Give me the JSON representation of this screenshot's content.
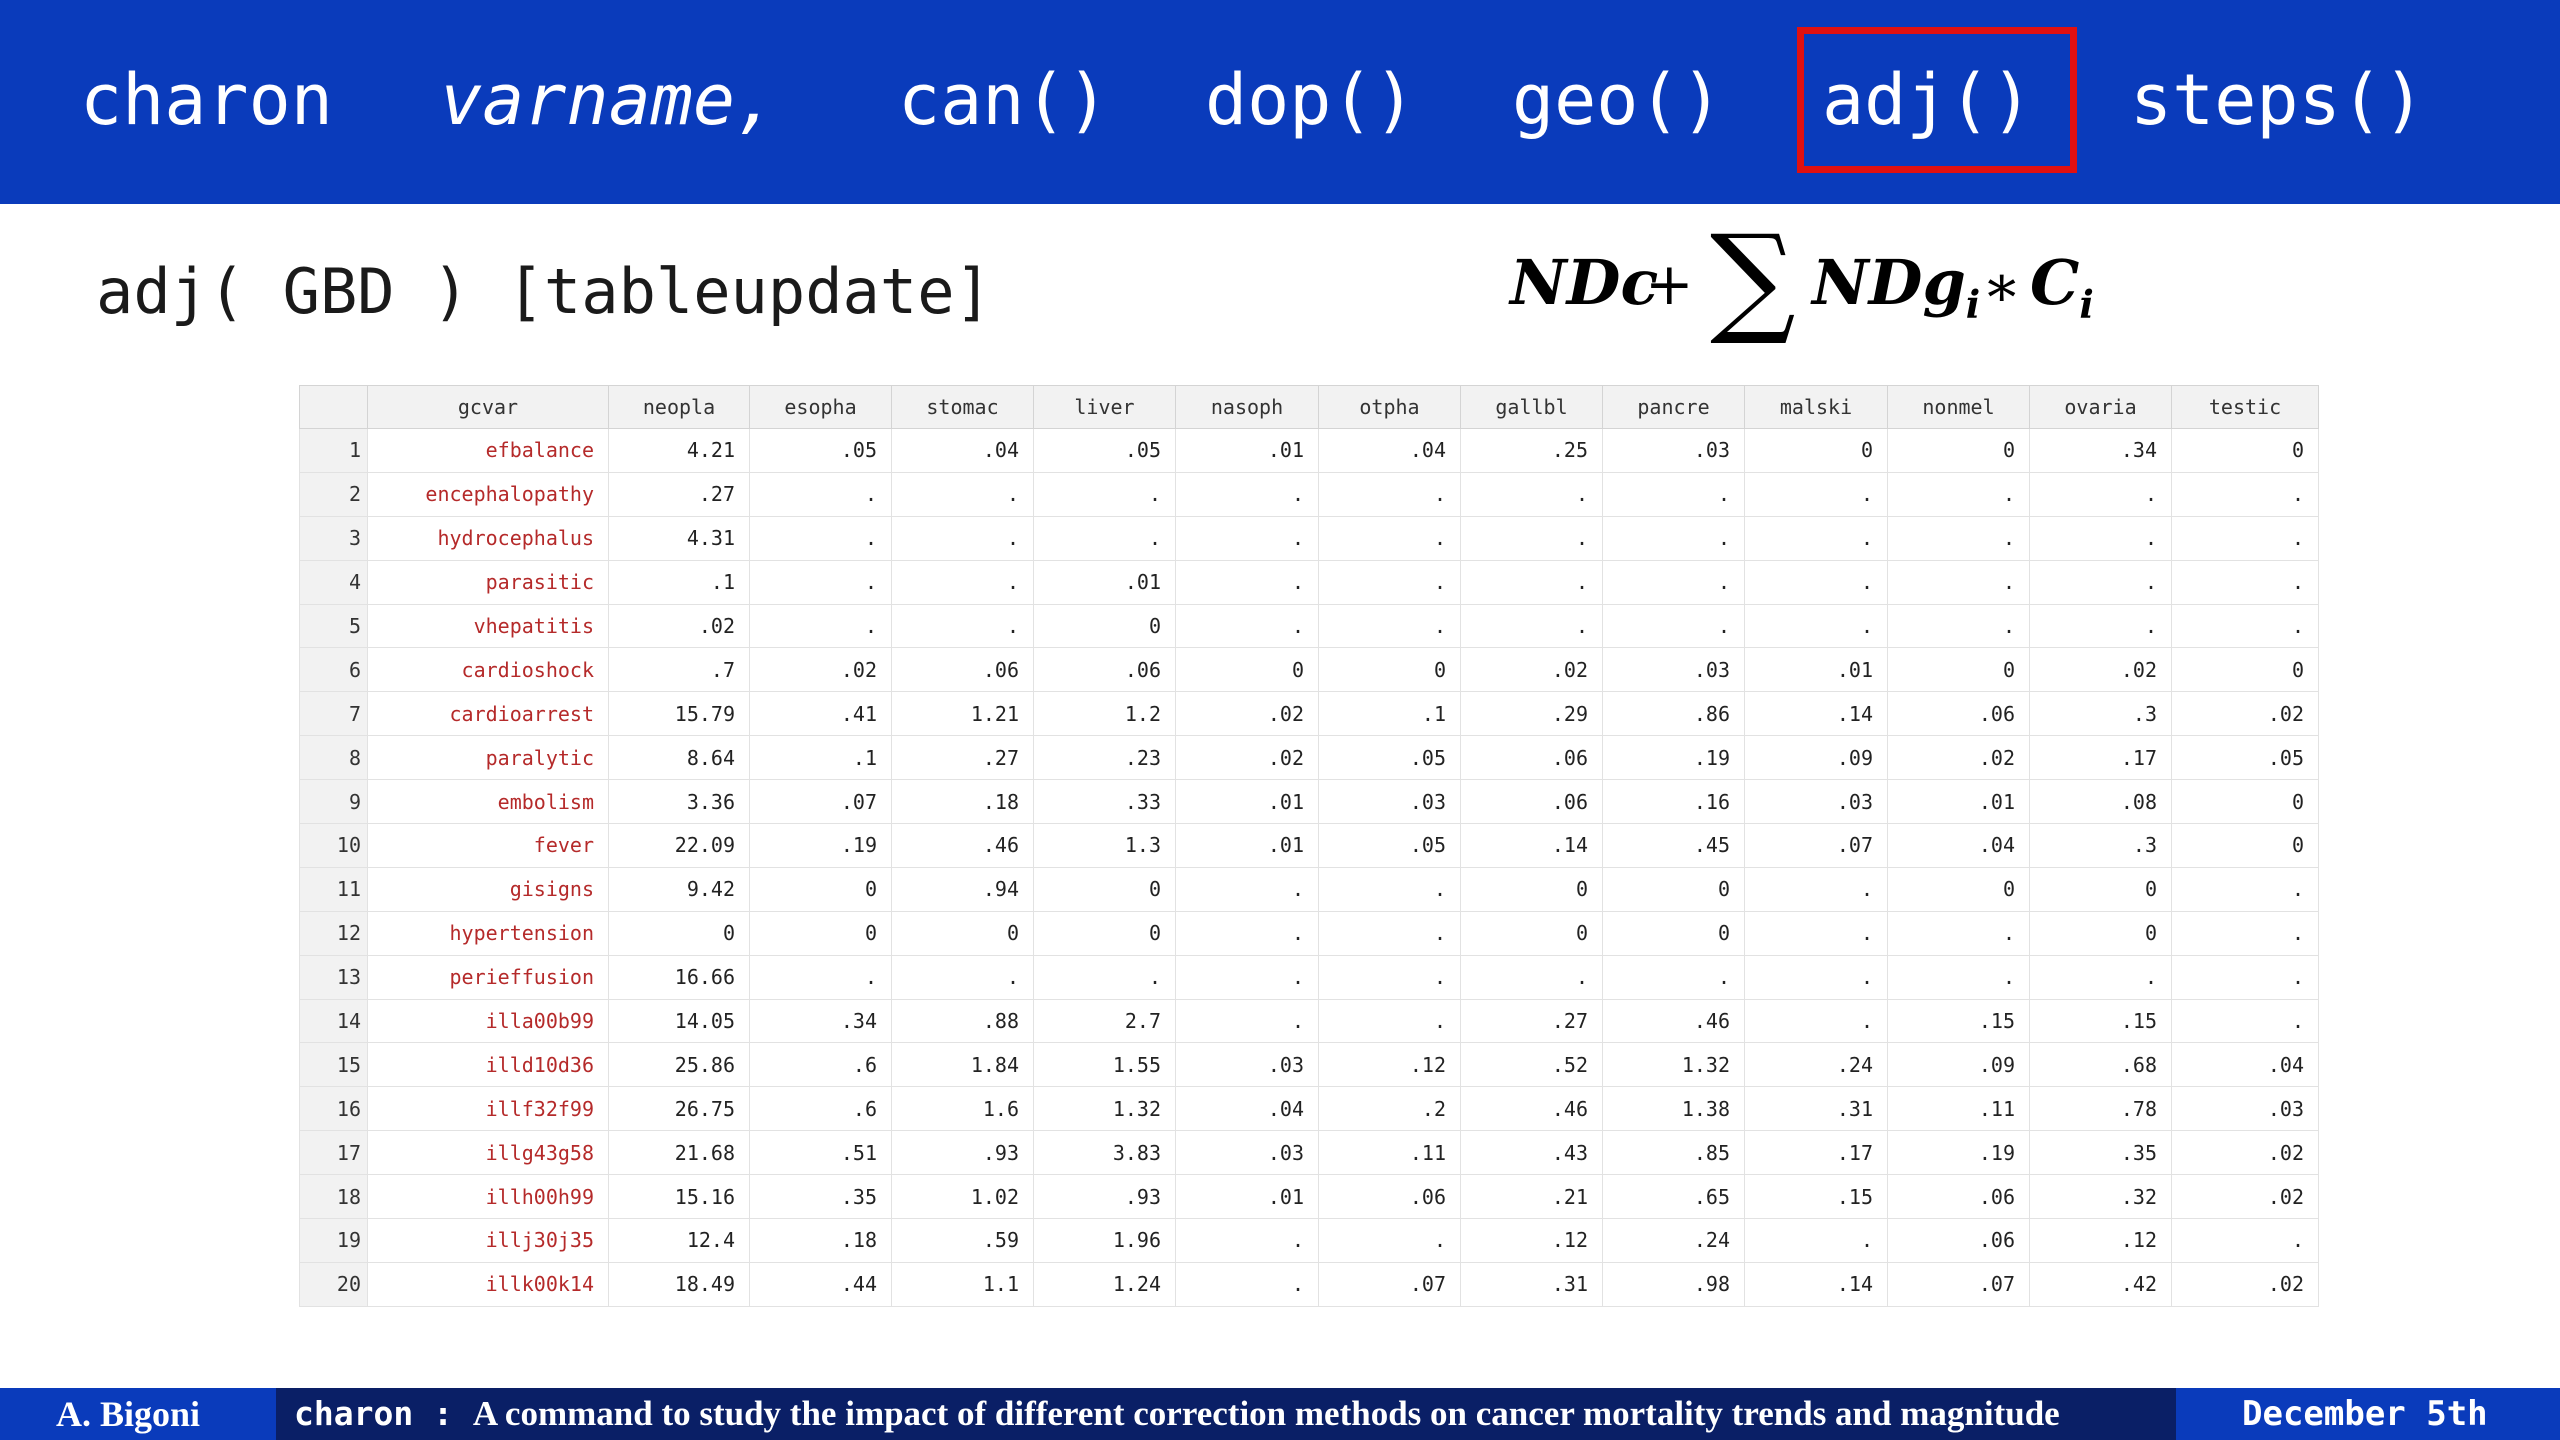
{
  "header": {
    "command": "charon",
    "varname": "varname,",
    "options": [
      "can()",
      "dop()",
      "geo()",
      "adj()",
      "steps()"
    ],
    "highlighted": "adj()",
    "highlight_color": "#e01010",
    "bg_color": "#0a3bbb"
  },
  "subtitle": "adj( GBD ) [tableupdate]",
  "formula": {
    "ndc": "NDc",
    "plus": "+",
    "sigma": "∑",
    "ndg": "NDg",
    "sub_i": "i",
    "times": "∗",
    "c": "C",
    "sub_i2": "i"
  },
  "table": {
    "columns": [
      "",
      "gcvar",
      "neopla",
      "esopha",
      "stomac",
      "liver",
      "nasoph",
      "otpha",
      "gallbl",
      "pancre",
      "malski",
      "nonmel",
      "ovaria",
      "testic"
    ],
    "rows": [
      [
        "1",
        "efbalance",
        "4.21",
        ".05",
        ".04",
        ".05",
        ".01",
        ".04",
        ".25",
        ".03",
        "0",
        "0",
        ".34",
        "0"
      ],
      [
        "2",
        "encephalopathy",
        ".27",
        ".",
        ".",
        ".",
        ".",
        ".",
        ".",
        ".",
        ".",
        ".",
        ".",
        "."
      ],
      [
        "3",
        "hydrocephalus",
        "4.31",
        ".",
        ".",
        ".",
        ".",
        ".",
        ".",
        ".",
        ".",
        ".",
        ".",
        "."
      ],
      [
        "4",
        "parasitic",
        ".1",
        ".",
        ".",
        ".01",
        ".",
        ".",
        ".",
        ".",
        ".",
        ".",
        ".",
        "."
      ],
      [
        "5",
        "vhepatitis",
        ".02",
        ".",
        ".",
        "0",
        ".",
        ".",
        ".",
        ".",
        ".",
        ".",
        ".",
        "."
      ],
      [
        "6",
        "cardioshock",
        ".7",
        ".02",
        ".06",
        ".06",
        "0",
        "0",
        ".02",
        ".03",
        ".01",
        "0",
        ".02",
        "0"
      ],
      [
        "7",
        "cardioarrest",
        "15.79",
        ".41",
        "1.21",
        "1.2",
        ".02",
        ".1",
        ".29",
        ".86",
        ".14",
        ".06",
        ".3",
        ".02"
      ],
      [
        "8",
        "paralytic",
        "8.64",
        ".1",
        ".27",
        ".23",
        ".02",
        ".05",
        ".06",
        ".19",
        ".09",
        ".02",
        ".17",
        ".05"
      ],
      [
        "9",
        "embolism",
        "3.36",
        ".07",
        ".18",
        ".33",
        ".01",
        ".03",
        ".06",
        ".16",
        ".03",
        ".01",
        ".08",
        "0"
      ],
      [
        "10",
        "fever",
        "22.09",
        ".19",
        ".46",
        "1.3",
        ".01",
        ".05",
        ".14",
        ".45",
        ".07",
        ".04",
        ".3",
        "0"
      ],
      [
        "11",
        "gisigns",
        "9.42",
        "0",
        ".94",
        "0",
        ".",
        ".",
        "0",
        "0",
        ".",
        "0",
        "0",
        "."
      ],
      [
        "12",
        "hypertension",
        "0",
        "0",
        "0",
        "0",
        ".",
        ".",
        "0",
        "0",
        ".",
        ".",
        "0",
        "."
      ],
      [
        "13",
        "perieffusion",
        "16.66",
        ".",
        ".",
        ".",
        ".",
        ".",
        ".",
        ".",
        ".",
        ".",
        ".",
        "."
      ],
      [
        "14",
        "illa00b99",
        "14.05",
        ".34",
        ".88",
        "2.7",
        ".",
        ".",
        ".27",
        ".46",
        ".",
        ".15",
        ".15",
        "."
      ],
      [
        "15",
        "illd10d36",
        "25.86",
        ".6",
        "1.84",
        "1.55",
        ".03",
        ".12",
        ".52",
        "1.32",
        ".24",
        ".09",
        ".68",
        ".04"
      ],
      [
        "16",
        "illf32f99",
        "26.75",
        ".6",
        "1.6",
        "1.32",
        ".04",
        ".2",
        ".46",
        "1.38",
        ".31",
        ".11",
        ".78",
        ".03"
      ],
      [
        "17",
        "illg43g58",
        "21.68",
        ".51",
        ".93",
        "3.83",
        ".03",
        ".11",
        ".43",
        ".85",
        ".17",
        ".19",
        ".35",
        ".02"
      ],
      [
        "18",
        "illh00h99",
        "15.16",
        ".35",
        "1.02",
        ".93",
        ".01",
        ".06",
        ".21",
        ".65",
        ".15",
        ".06",
        ".32",
        ".02"
      ],
      [
        "19",
        "illj30j35",
        "12.4",
        ".18",
        ".59",
        "1.96",
        ".",
        ".",
        ".12",
        ".24",
        ".",
        ".06",
        ".12",
        "."
      ],
      [
        "20",
        "illk00k14",
        "18.49",
        ".44",
        "1.1",
        "1.24",
        ".",
        ".07",
        ".31",
        ".98",
        ".14",
        ".07",
        ".42",
        ".02"
      ]
    ]
  },
  "footer": {
    "author": "A. Bigoni",
    "command": "charon",
    "separator": " : ",
    "description": "A command to study the impact of different correction methods on cancer mortality trends and magnitude",
    "date": "December 5th"
  }
}
